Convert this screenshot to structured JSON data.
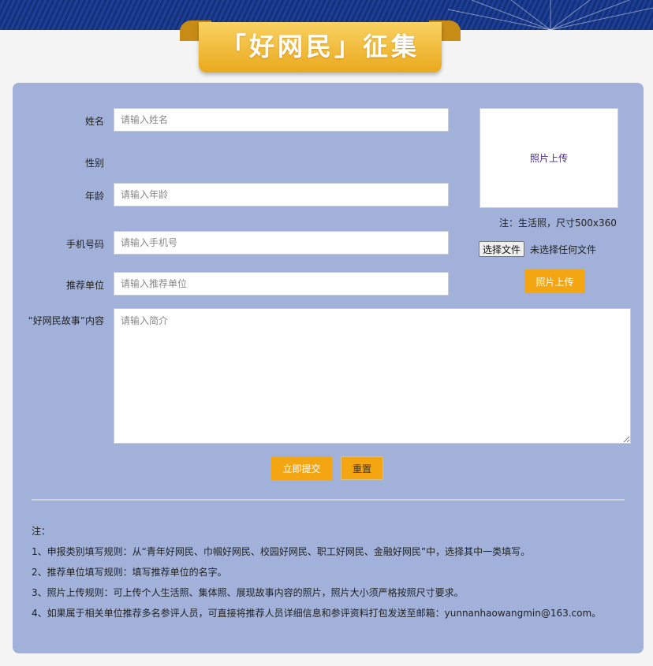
{
  "header": {
    "title": "「好网民」征集"
  },
  "form": {
    "name_label": "姓名",
    "name_placeholder": "请输入姓名",
    "gender_label": "性别",
    "age_label": "年龄",
    "age_placeholder": "请输入年龄",
    "phone_label": "手机号码",
    "phone_placeholder": "请输入手机号",
    "unit_label": "推荐单位",
    "unit_placeholder": "请输入推荐单位",
    "story_label": "“好网民故事”内容",
    "story_placeholder": "请输入简介"
  },
  "photo": {
    "box_label": "照片上传",
    "note": "注：生活照，尺寸500x360",
    "choose_file_label": "选择文件",
    "file_status": "未选择任何文件",
    "upload_label": "照片上传"
  },
  "actions": {
    "submit_label": "立即提交",
    "reset_label": "重置"
  },
  "notes": {
    "heading": "注：",
    "items": [
      "1、申报类别填写规则：从“青年好网民、巾帼好网民、校园好网民、职工好网民、金融好网民”中，选择其中一类填写。",
      "2、推荐单位填写规则：填写推荐单位的名字。",
      "3、照片上传规则：可上传个人生活照、集体照、展现故事内容的照片，照片大小须严格按照尺寸要求。",
      "4、如果属于相关单位推荐多名参评人员，可直接将推荐人员详细信息和参评资料打包发送至邮箱：yunnanhaowangmin@163.com。"
    ]
  },
  "colors": {
    "panel_bg": "#a1b1d9",
    "accent": "#f3a512",
    "banner": "#1d3f96"
  }
}
